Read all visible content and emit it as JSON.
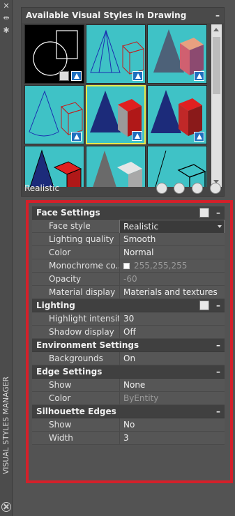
{
  "palette": {
    "title": "VISUAL STYLES MANAGER"
  },
  "gallery": {
    "title": "Available Visual Styles in Drawing",
    "collapse_label": "–",
    "current_style": "Realistic"
  },
  "sections": {
    "face": {
      "title": "Face Settings",
      "collapse_label": "–",
      "rows": {
        "face_style": {
          "label": "Face style",
          "value": "Realistic"
        },
        "lighting_quality": {
          "label": "Lighting quality",
          "value": "Smooth"
        },
        "color": {
          "label": "Color",
          "value": "Normal"
        },
        "mono_color": {
          "label": "Monochrome co...",
          "value": "255,255,255"
        },
        "opacity": {
          "label": "Opacity",
          "value": "-60"
        },
        "material_display": {
          "label": "Material display",
          "value": "Materials and textures"
        }
      }
    },
    "lighting": {
      "title": "Lighting",
      "collapse_label": "–",
      "rows": {
        "highlight": {
          "label": "Highlight intensity",
          "value": "30"
        },
        "shadow": {
          "label": "Shadow display",
          "value": "Off"
        }
      }
    },
    "environment": {
      "title": "Environment Settings",
      "collapse_label": "–",
      "rows": {
        "backgrounds": {
          "label": "Backgrounds",
          "value": "On"
        }
      }
    },
    "edge": {
      "title": "Edge Settings",
      "collapse_label": "–",
      "rows": {
        "show": {
          "label": "Show",
          "value": "None"
        },
        "color": {
          "label": "Color",
          "value": "ByEntity"
        }
      }
    },
    "silhouette": {
      "title": "Silhouette Edges",
      "collapse_label": "–",
      "rows": {
        "show": {
          "label": "Show",
          "value": "No"
        },
        "width": {
          "label": "Width",
          "value": "3"
        }
      }
    }
  },
  "colors": {
    "highlight_border": "#d4202a",
    "tile_bg": "#3fc2c6",
    "selected_tile_border": "#e8e84a"
  }
}
